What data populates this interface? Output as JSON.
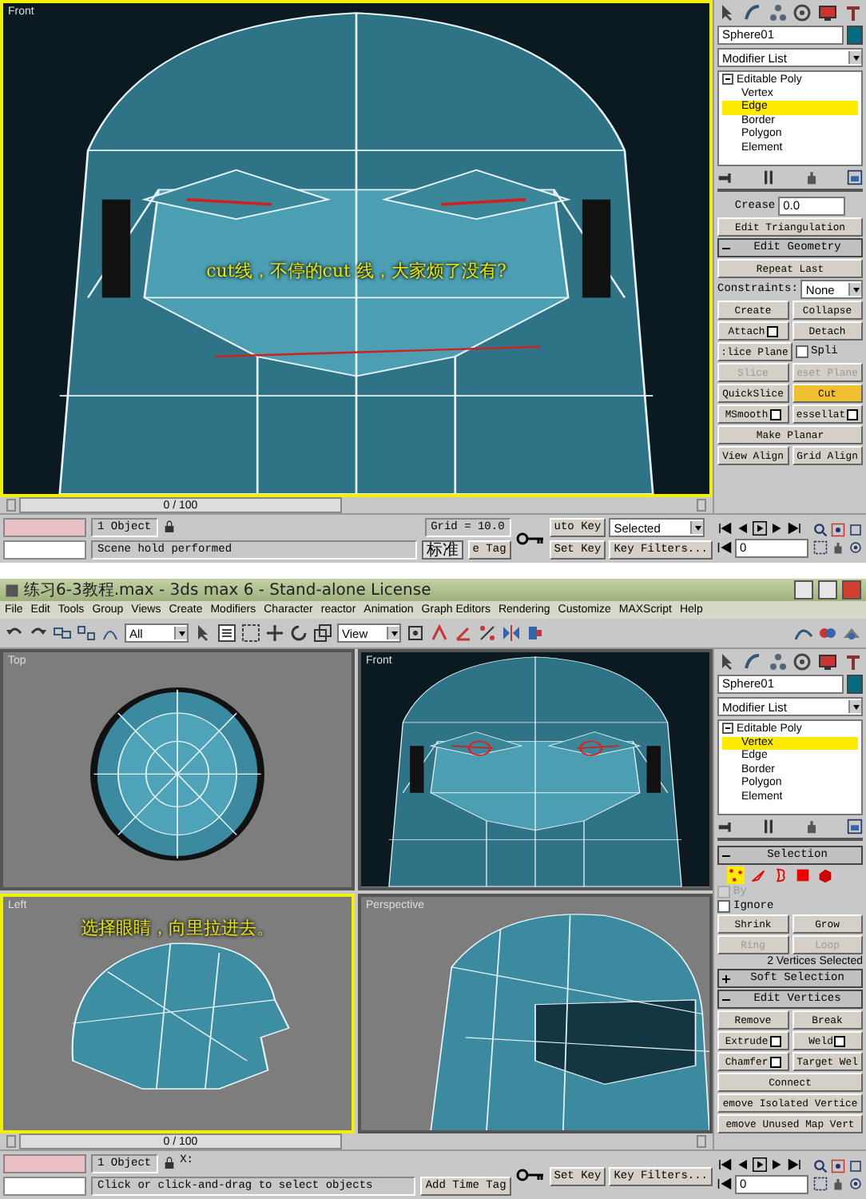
{
  "top": {
    "viewport": {
      "label": "Front",
      "active": true,
      "kind": "front",
      "caption": "cut线，不停的cut 线，大家烦了没有?"
    },
    "timeline": {
      "label": "0 / 100",
      "level": 0
    },
    "panel": {
      "object_name": "Sphere01",
      "modifier_list": "Modifier List",
      "stack": [
        {
          "label": "Editable Poly",
          "expanded": true,
          "children": [
            {
              "label": "Vertex",
              "selected": false
            },
            {
              "label": "Edge",
              "selected": true
            },
            {
              "label": "Border",
              "selected": false
            },
            {
              "label": "Polygon",
              "selected": false
            },
            {
              "label": "Element",
              "selected": false
            }
          ]
        }
      ],
      "rows": [
        {
          "kind": "spinner",
          "label": "Crease",
          "value": "0.0"
        },
        {
          "kind": "buttons",
          "items": [
            {
              "kind": "button",
              "label": "Edit Triangulation",
              "disabled": false,
              "selected": false
            }
          ]
        },
        {
          "kind": "header",
          "label": "Edit Geometry",
          "expanded": true
        },
        {
          "kind": "buttons",
          "items": [
            {
              "kind": "button",
              "label": "Repeat Last",
              "disabled": false,
              "selected": false
            }
          ]
        },
        {
          "kind": "dropdown",
          "label": "Constraints:",
          "value": "None"
        },
        {
          "kind": "buttons",
          "items": [
            {
              "kind": "button",
              "label": "Create",
              "disabled": false,
              "selected": false
            },
            {
              "kind": "button",
              "label": "Collapse",
              "disabled": false,
              "selected": false
            }
          ]
        },
        {
          "kind": "buttons",
          "items": [
            {
              "kind": "button",
              "label": "Attach",
              "disabled": false,
              "selected": false,
              "settings": true
            },
            {
              "kind": "button",
              "label": "Detach",
              "disabled": false,
              "selected": false
            }
          ]
        },
        {
          "kind": "buttons",
          "items": [
            {
              "kind": "button",
              "label": ":lice Plane",
              "disabled": false,
              "selected": false
            },
            {
              "kind": "checkbox",
              "label": "Spli",
              "checked": false,
              "disabled": false
            }
          ]
        },
        {
          "kind": "buttons",
          "items": [
            {
              "kind": "button",
              "label": "Slice",
              "disabled": true,
              "selected": false
            },
            {
              "kind": "button",
              "label": "eset Plane",
              "disabled": true,
              "selected": false
            }
          ]
        },
        {
          "kind": "buttons",
          "items": [
            {
              "kind": "button",
              "label": "QuickSlice",
              "disabled": false,
              "selected": false
            },
            {
              "kind": "button",
              "label": "Cut",
              "disabled": false,
              "selected": true
            }
          ]
        },
        {
          "kind": "buttons",
          "items": [
            {
              "kind": "button",
              "label": "MSmooth",
              "disabled": false,
              "selected": false,
              "settings": true
            },
            {
              "kind": "button",
              "label": "essellat",
              "disabled": false,
              "selected": false,
              "settings": true
            }
          ]
        },
        {
          "kind": "buttons",
          "items": [
            {
              "kind": "button",
              "label": "Make Planar",
              "disabled": false,
              "selected": false
            }
          ]
        },
        {
          "kind": "buttons",
          "items": [
            {
              "kind": "button",
              "label": "View Align",
              "disabled": false,
              "selected": false
            },
            {
              "kind": "button",
              "label": "Grid Align",
              "disabled": false,
              "selected": false
            }
          ]
        }
      ]
    },
    "status": {
      "selection": "1 Object",
      "prompt": "Scene hold performed",
      "grid": "Grid = 10.0",
      "ime": "标准",
      "time_tag": "e Tag",
      "auto_key": "uto Key",
      "key_mode": "Selected",
      "set_key": "Set Key",
      "key_filters": "Key Filters...",
      "frame": "0"
    }
  },
  "bottom": {
    "window": {
      "title": "练习6-3教程.max - 3ds max 6 - Stand-alone License"
    },
    "menu": [
      "File",
      "Edit",
      "Tools",
      "Group",
      "Views",
      "Create",
      "Modifiers",
      "Character",
      "reactor",
      "Animation",
      "Graph Editors",
      "Rendering",
      "Customize",
      "MAXScript",
      "Help"
    ],
    "toolbar": {
      "selection_filter": "All",
      "coord_system": "View"
    },
    "viewports": [
      {
        "label": "Top",
        "active": false,
        "kind": "top"
      },
      {
        "label": "Front",
        "active": false,
        "kind": "front"
      },
      {
        "label": "Left",
        "active": true,
        "kind": "side",
        "caption": "选择眼睛，向里拉进去。"
      },
      {
        "label": "Perspective",
        "active": false,
        "kind": "perspective"
      }
    ],
    "timeline": {
      "label": "0 / 100",
      "level": 0
    },
    "panel": {
      "object_name": "Sphere01",
      "modifier_list": "Modifier List",
      "stack": [
        {
          "label": "Editable Poly",
          "expanded": true,
          "children": [
            {
              "label": "Vertex",
              "selected": true
            },
            {
              "label": "Edge",
              "selected": false
            },
            {
              "label": "Border",
              "selected": false
            },
            {
              "label": "Polygon",
              "selected": false
            },
            {
              "label": "Element",
              "selected": false
            }
          ]
        }
      ],
      "rows": [
        {
          "kind": "header",
          "label": "Selection",
          "expanded": true
        },
        {
          "kind": "levels",
          "items": [
            {
              "kind": "vertex",
              "selected": true
            },
            {
              "kind": "edge",
              "selected": false
            },
            {
              "kind": "border",
              "selected": false
            },
            {
              "kind": "polygon",
              "selected": false
            },
            {
              "kind": "element",
              "selected": false
            }
          ]
        },
        {
          "kind": "buttons",
          "items": [
            {
              "kind": "checkbox",
              "label": "By",
              "checked": false,
              "disabled": true
            }
          ]
        },
        {
          "kind": "buttons",
          "items": [
            {
              "kind": "checkbox",
              "label": "Ignore",
              "checked": false,
              "disabled": false
            }
          ]
        },
        {
          "kind": "buttons",
          "items": [
            {
              "kind": "button",
              "label": "Shrink",
              "disabled": false,
              "selected": false
            },
            {
              "kind": "button",
              "label": "Grow",
              "disabled": false,
              "selected": false
            }
          ]
        },
        {
          "kind": "buttons",
          "items": [
            {
              "kind": "button",
              "label": "Ring",
              "disabled": true,
              "selected": false
            },
            {
              "kind": "button",
              "label": "Loop",
              "disabled": true,
              "selected": false
            }
          ]
        },
        {
          "kind": "note",
          "text": "2 Vertices Selected"
        },
        {
          "kind": "header",
          "label": "Soft Selection",
          "expanded": false
        },
        {
          "kind": "header",
          "label": "Edit Vertices",
          "expanded": true
        },
        {
          "kind": "buttons",
          "items": [
            {
              "kind": "button",
              "label": "Remove",
              "disabled": false,
              "selected": false
            },
            {
              "kind": "button",
              "label": "Break",
              "disabled": false,
              "selected": false
            }
          ]
        },
        {
          "kind": "buttons",
          "items": [
            {
              "kind": "button",
              "label": "Extrude",
              "disabled": false,
              "selected": false,
              "settings": true
            },
            {
              "kind": "button",
              "label": "Weld",
              "disabled": false,
              "selected": false,
              "settings": true
            }
          ]
        },
        {
          "kind": "buttons",
          "items": [
            {
              "kind": "button",
              "label": "Chamfer",
              "disabled": false,
              "selected": false,
              "settings": true
            },
            {
              "kind": "button",
              "label": "Target Wel",
              "disabled": false,
              "selected": false
            }
          ]
        },
        {
          "kind": "buttons",
          "items": [
            {
              "kind": "button",
              "label": "Connect",
              "disabled": false,
              "selected": false
            }
          ]
        },
        {
          "kind": "buttons",
          "items": [
            {
              "kind": "button",
              "label": "emove Isolated Vertice",
              "disabled": false,
              "selected": false
            }
          ]
        },
        {
          "kind": "buttons",
          "items": [
            {
              "kind": "button",
              "label": "emove Unused Map Vert",
              "disabled": false,
              "selected": false
            }
          ]
        }
      ]
    },
    "status": {
      "selection": "1 Object",
      "coord_label": "X:",
      "prompt": "Click or click-and-drag to select objects",
      "time_tag": "Add Time Tag",
      "set_key": "Set Key",
      "key_filters": "Key Filters...",
      "frame": "0"
    }
  }
}
